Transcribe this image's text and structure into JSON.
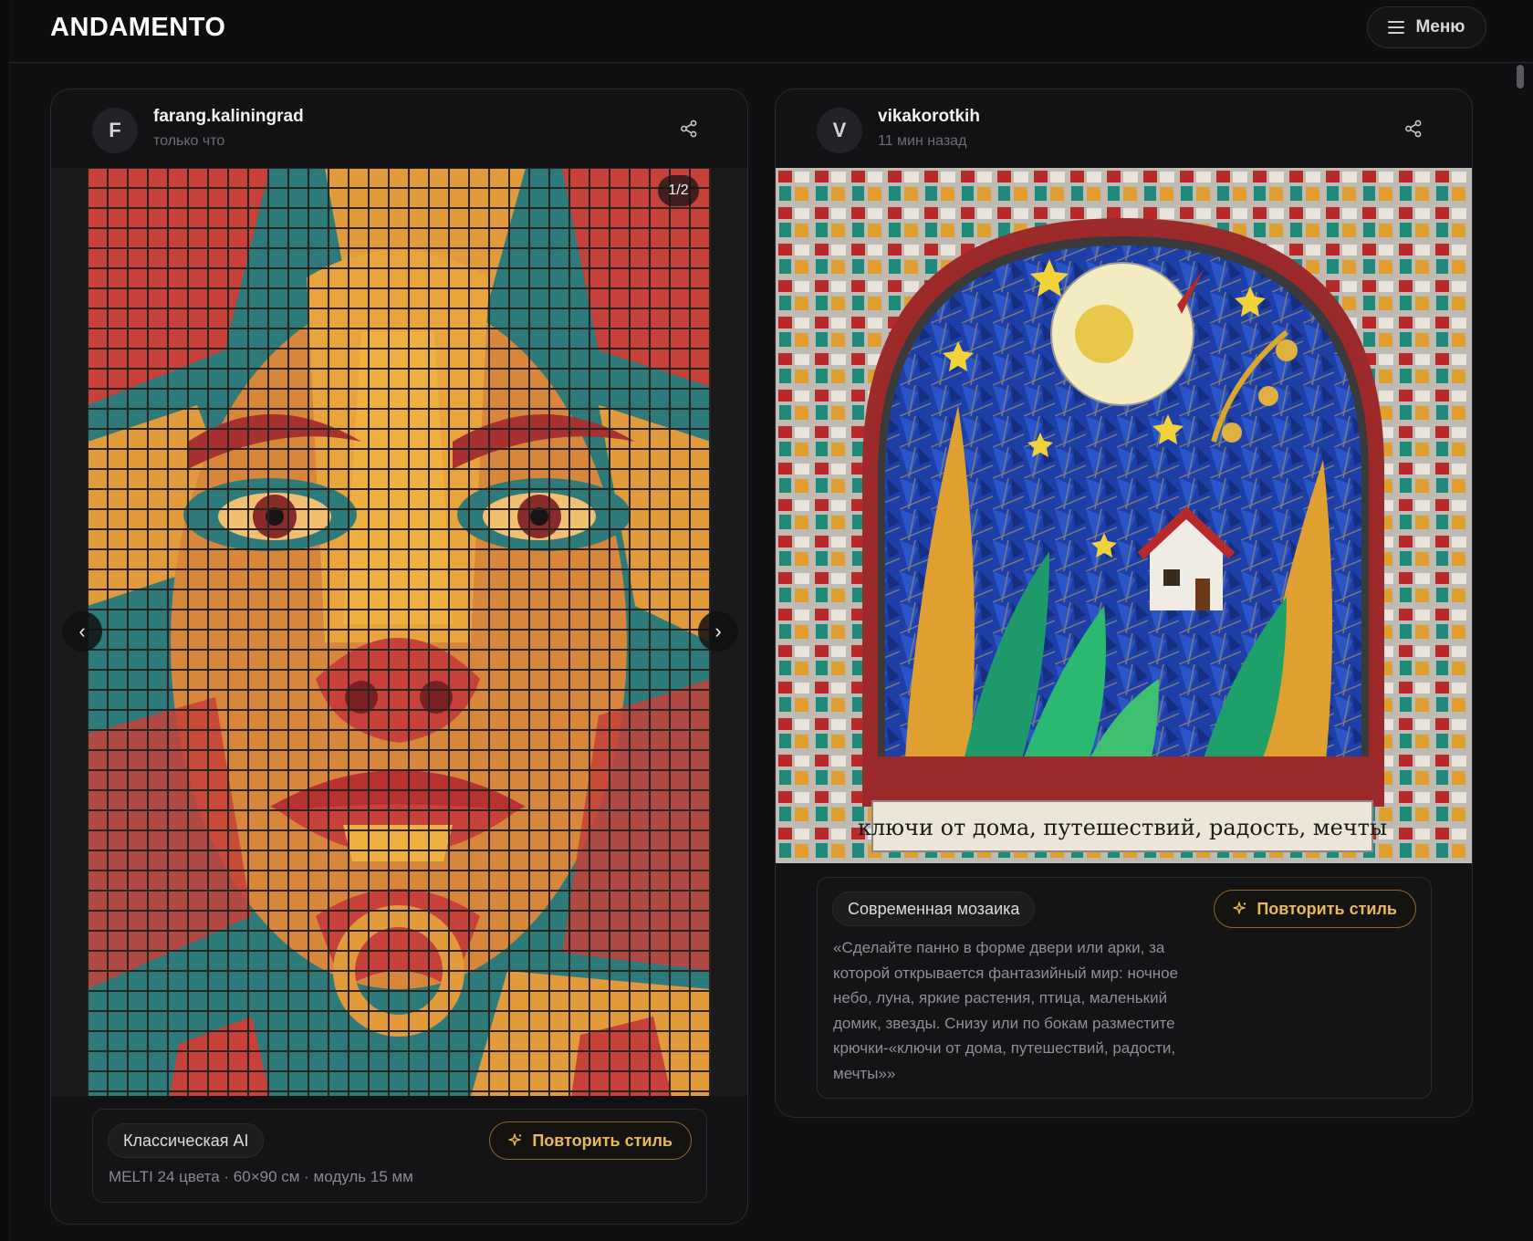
{
  "app": {
    "logo": "ANDAMENTO",
    "menu_label": "Меню"
  },
  "posts": [
    {
      "avatar_letter": "F",
      "username": "farang.kaliningrad",
      "time": "только что",
      "counter": "1/2",
      "prev_glyph": "‹",
      "next_glyph": "›",
      "style_tag": "Классическая AI",
      "repeat_label": "Повторить стиль",
      "meta": "MELTI 24 цвета · 60×90 см · модуль 15 мм",
      "image_description": "mosaic-face-portrait"
    },
    {
      "avatar_letter": "V",
      "username": "vikakorotkih",
      "time": "11 мин назад",
      "style_tag": "Современная мозаика",
      "repeat_label": "Повторить стиль",
      "prompt": "«Сделайте панно в форме двери или арки, за которой открывается фантазийный мир: ночное небо, луна, яркие растения, птица, маленький домик, звезды. Снизу или по бокам разместите крючки-«ключи от дома, путешествий, радости, мечты»»",
      "image_caption": "ключи от дома, путешествий, радость, мечты",
      "image_description": "stained-glass-arch-night"
    }
  ],
  "colors": {
    "accent": "#e7b95a",
    "background": "#101012",
    "card": "#121214"
  }
}
